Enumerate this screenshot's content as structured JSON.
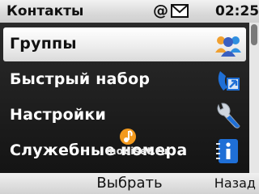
{
  "status_bar": {
    "title": "Контакты",
    "indicator_at": "@",
    "icons": [
      "envelope-icon"
    ],
    "time": "02:25"
  },
  "menu": {
    "items": [
      {
        "label": "Группы",
        "icon": "group-icon",
        "selected": true
      },
      {
        "label": "Быстрый набор",
        "icon": "speed-dial-icon",
        "selected": false
      },
      {
        "label": "Настройки",
        "icon": "wrench-icon",
        "selected": false
      },
      {
        "label": "Служебные номера",
        "icon": "info-icon",
        "selected": false
      }
    ]
  },
  "watermark": {
    "text": "mobiset.ru",
    "icon": "music-note-logo-icon"
  },
  "softkeys": {
    "select": "Выбрать",
    "back": "Назад"
  },
  "colors": {
    "accent_blue": "#1f6fd6",
    "selection_bg": "#f2f2f2",
    "list_bg": "#1e1e1e",
    "logo_orange": "#f39a1e"
  }
}
